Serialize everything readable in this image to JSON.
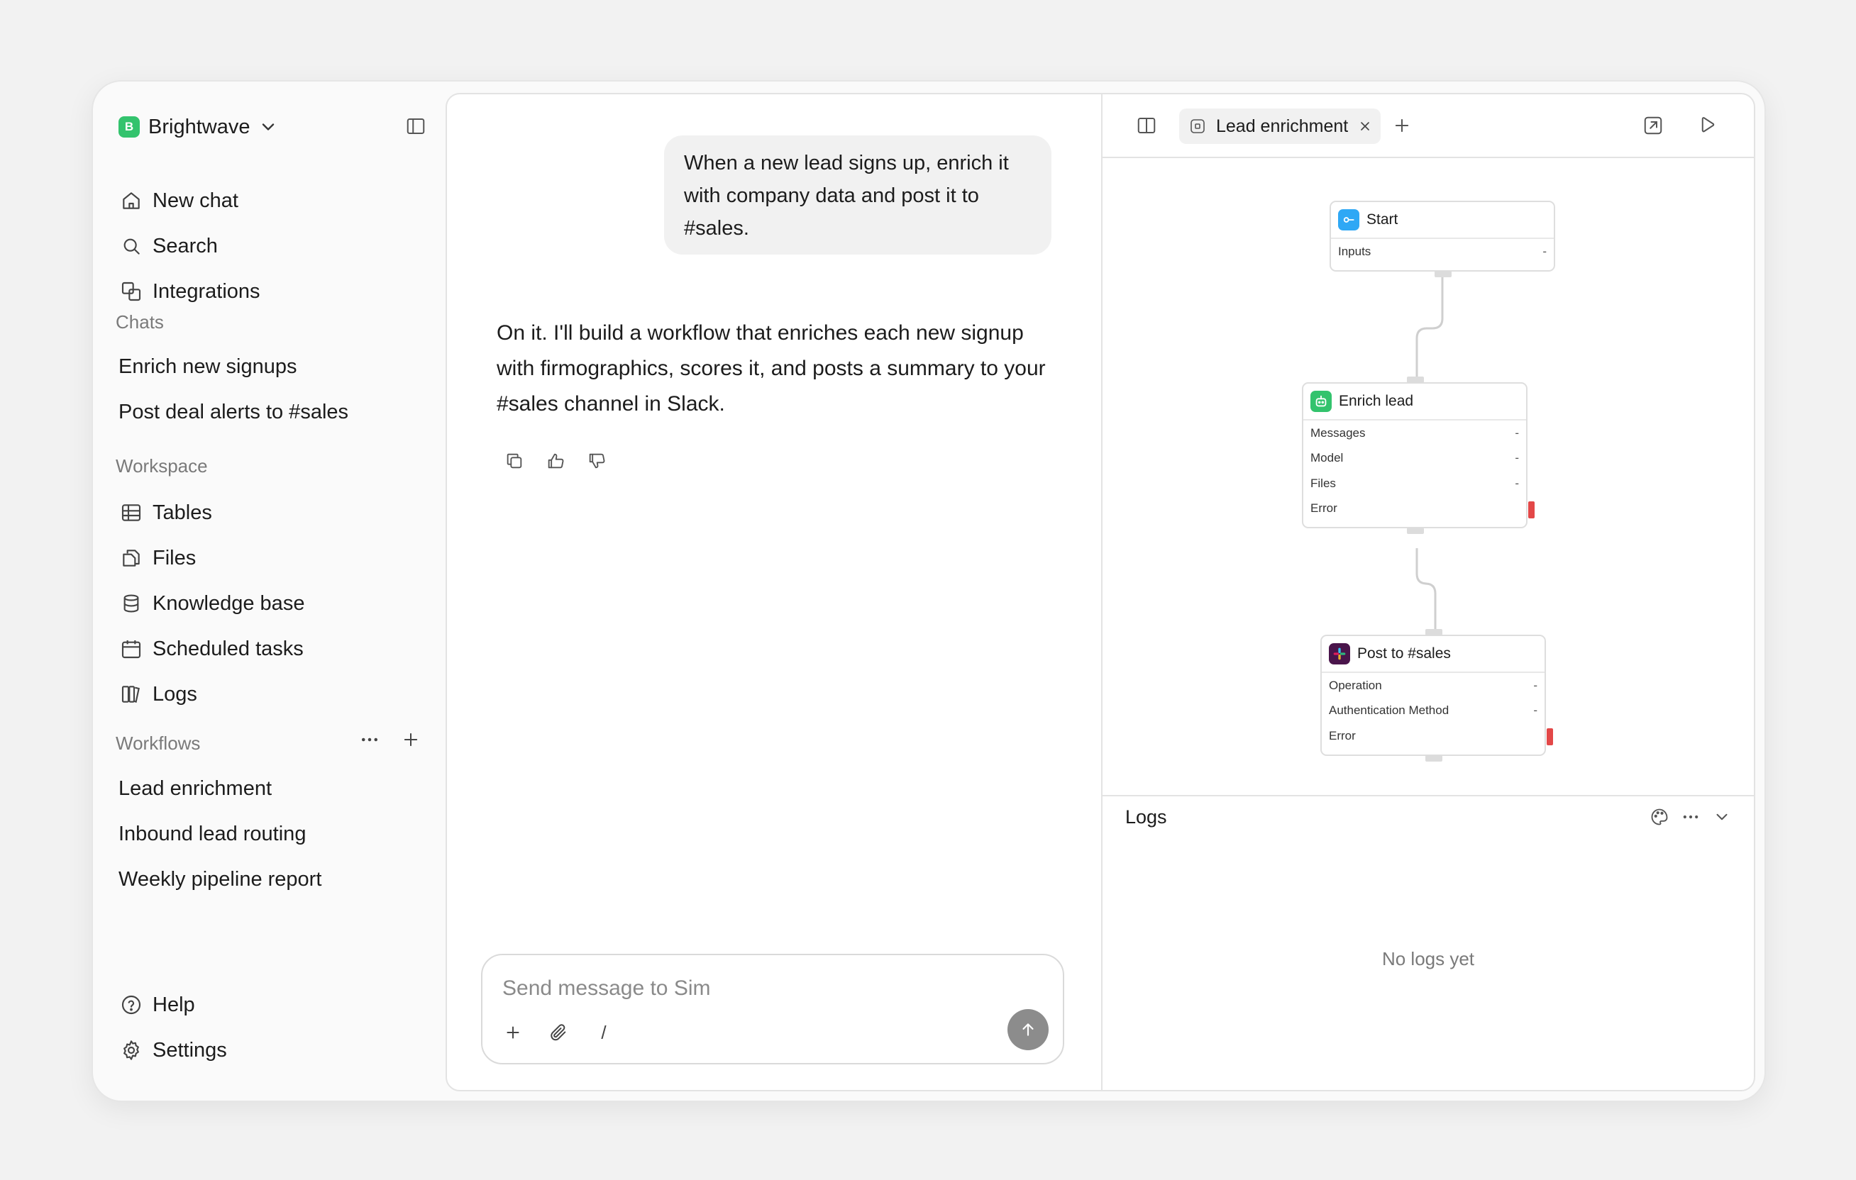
{
  "workspace": {
    "badge": "B",
    "name": "Brightwave"
  },
  "nav": {
    "new_chat": "New chat",
    "search": "Search",
    "integrations": "Integrations"
  },
  "chats": {
    "label": "Chats",
    "items": [
      "Enrich new signups",
      "Post deal alerts to #sales"
    ]
  },
  "workspace_section": {
    "label": "Workspace",
    "items": [
      {
        "label": "Tables",
        "icon": "table-icon"
      },
      {
        "label": "Files",
        "icon": "files-icon"
      },
      {
        "label": "Knowledge base",
        "icon": "database-icon"
      },
      {
        "label": "Scheduled tasks",
        "icon": "calendar-icon"
      },
      {
        "label": "Logs",
        "icon": "logs-icon"
      }
    ]
  },
  "workflows": {
    "label": "Workflows",
    "items": [
      "Lead enrichment",
      "Inbound lead routing",
      "Weekly pipeline report"
    ]
  },
  "footer": {
    "help": "Help",
    "settings": "Settings"
  },
  "chat": {
    "user_message": "When a new lead signs up, enrich it with company data and post it to #sales.",
    "assistant_message": "On it. I'll build a workflow that enriches each new signup with firmographics, scores it, and posts a summary to your #sales channel in Slack.",
    "composer_placeholder": "Send message to Sim",
    "slash": "/"
  },
  "workflow_panel": {
    "tab_label": "Lead enrichment",
    "nodes": {
      "start": {
        "title": "Start",
        "rows": [
          {
            "label": "Inputs",
            "value": "-"
          }
        ]
      },
      "enrich": {
        "title": "Enrich lead",
        "rows": [
          {
            "label": "Messages",
            "value": "-"
          },
          {
            "label": "Model",
            "value": "-"
          },
          {
            "label": "Files",
            "value": "-"
          },
          {
            "label": "Error",
            "value": ""
          }
        ]
      },
      "post": {
        "title": "Post to #sales",
        "rows": [
          {
            "label": "Operation",
            "value": "-"
          },
          {
            "label": "Authentication Method",
            "value": "-"
          },
          {
            "label": "Error",
            "value": ""
          }
        ]
      }
    },
    "logs": {
      "title": "Logs",
      "empty": "No logs yet"
    }
  },
  "colors": {
    "brand": "#33c36d",
    "start_icon": "#2fa8f5",
    "agent_icon": "#33c36d",
    "slack_icon": "#4a154b",
    "error_handle": "#e34848"
  }
}
